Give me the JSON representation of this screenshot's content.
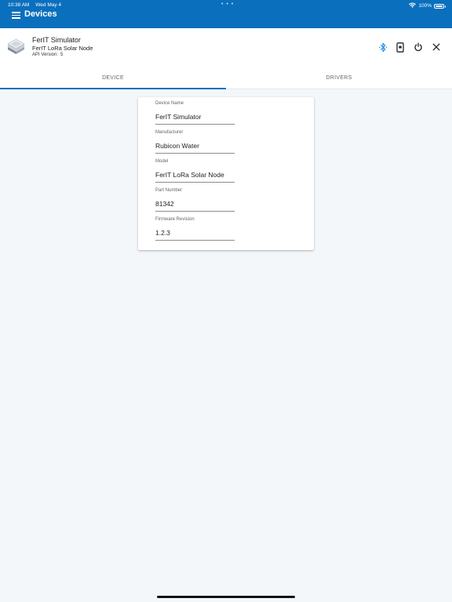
{
  "status_bar": {
    "time": "10:38 AM",
    "date": "Wed May 4",
    "dots": "• • •",
    "battery_percent": "100%"
  },
  "app_bar": {
    "title": "Devices",
    "background": "#0a6fbd"
  },
  "device": {
    "name": "FerIT Simulator",
    "model": "FerIT LoRa Solar Node",
    "api_label": "API Version:",
    "api_version": "5",
    "icon": "device-stack-icon",
    "actions": [
      "bluetooth-icon",
      "phone-device-icon",
      "power-icon",
      "close-icon"
    ]
  },
  "tabs": [
    {
      "label": "DEVICE",
      "active": true
    },
    {
      "label": "DRIVERS",
      "active": false
    }
  ],
  "fields": [
    {
      "label": "Device Name",
      "value": "FerIT Simulator"
    },
    {
      "label": "Manufacturer",
      "value": "Rubicon Water"
    },
    {
      "label": "Model",
      "value": "FerIT LoRa Solar Node"
    },
    {
      "label": "Part Number",
      "value": "81342"
    },
    {
      "label": "Firmware Revision",
      "value": "1.2.3"
    }
  ],
  "colors": {
    "accent": "#0a6fbd",
    "page_background": "#f4f7fa"
  }
}
